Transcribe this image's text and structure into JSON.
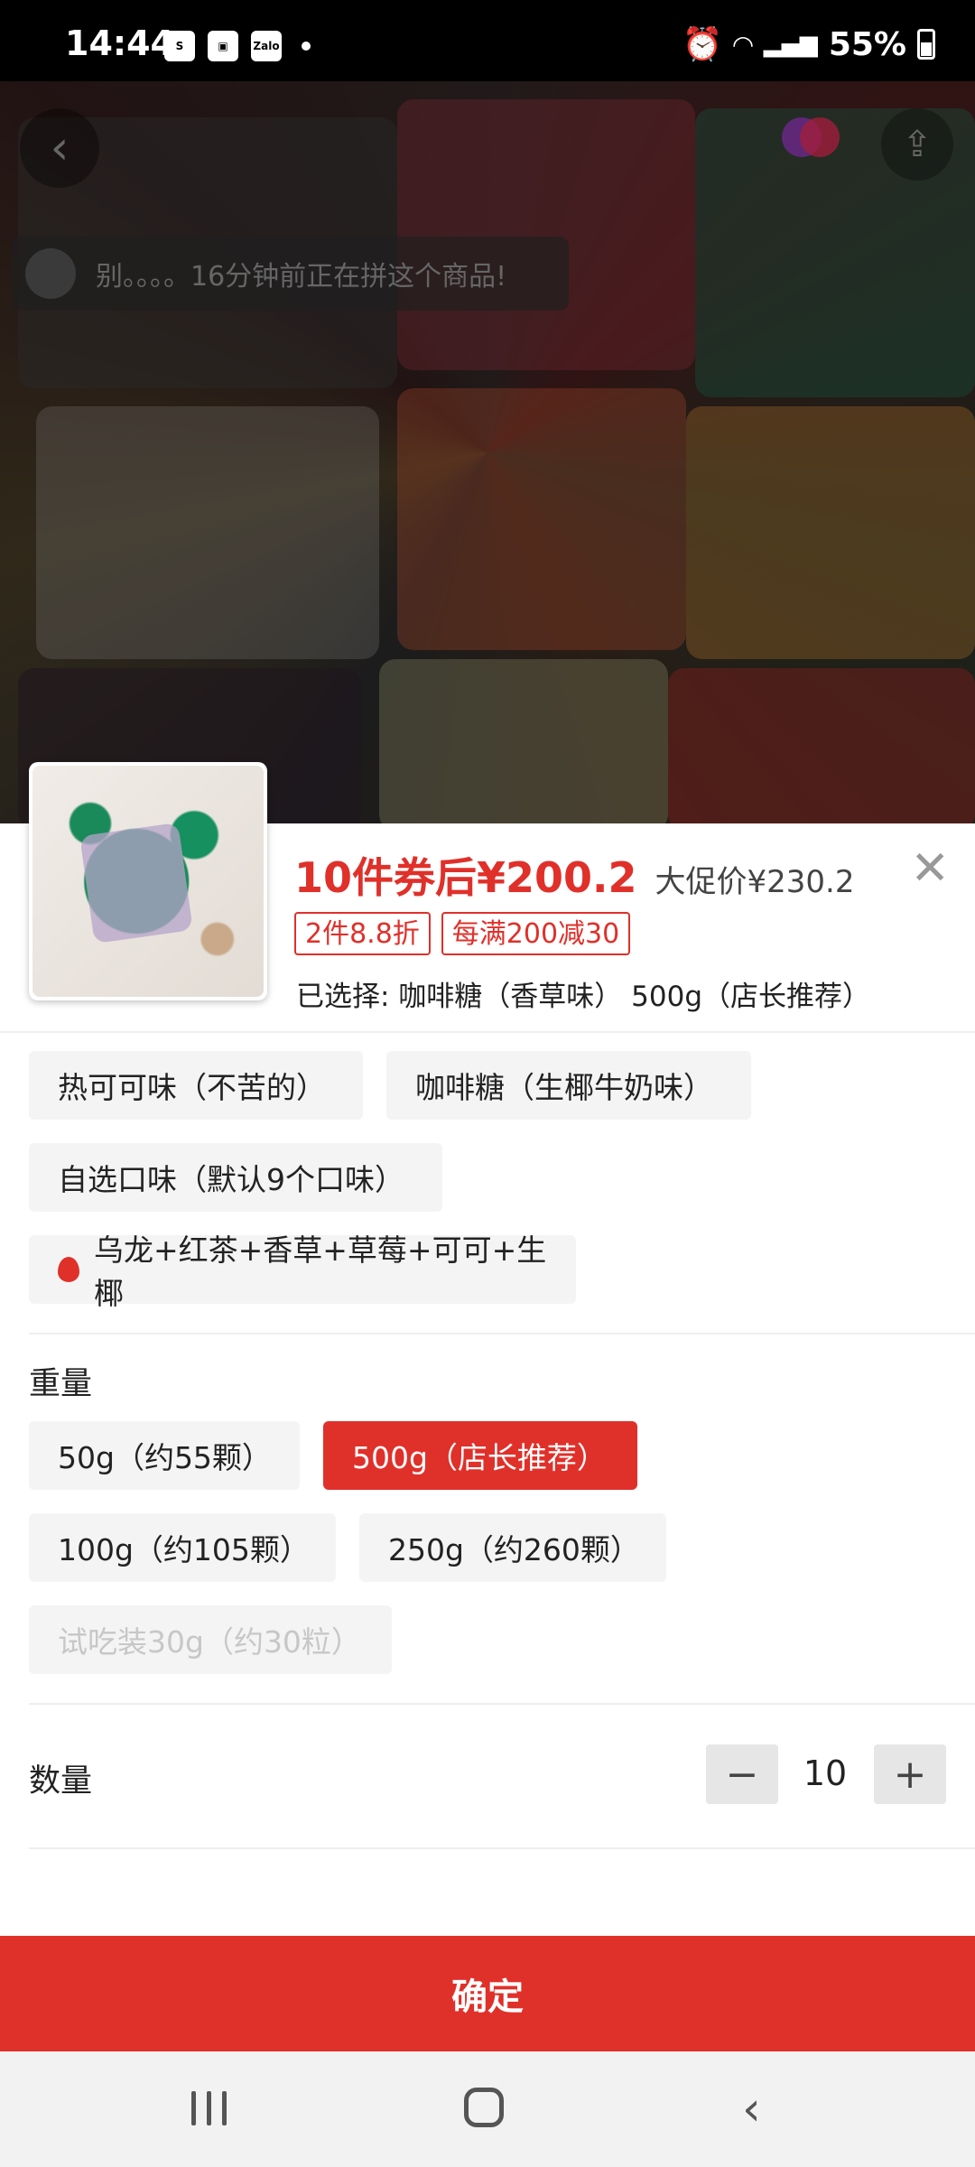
{
  "status_bar": {
    "time": "14:44",
    "battery": "55%",
    "left_icons": [
      "shopee-icon",
      "gallery-icon",
      "zalo-icon"
    ],
    "zalo_label": "Zalo",
    "shop_label": "S"
  },
  "hero": {
    "notice_text": "别。。。。16分钟前正在拼这个商品!"
  },
  "product": {
    "price_main": "10件券后¥200.2",
    "price_promo": "大促价¥230.2",
    "tags": [
      "2件8.8折",
      "每满200减30"
    ],
    "selected": "已选择:  咖啡糖（香草味） 500g（店长推荐）"
  },
  "flavors": [
    "热可可味（不苦的）",
    "咖啡糖（生椰牛奶味）",
    "自选口味（默认9个口味）",
    "乌龙+红茶+香草+草莓+可可+生椰"
  ],
  "weight": {
    "title": "重量",
    "options": [
      "50g（约55颗）",
      "500g（店长推荐）",
      "100g（约105颗）",
      "250g（约260颗）",
      "试吃装30g（约30粒）"
    ],
    "selected_index": 1,
    "disabled_index": 4
  },
  "quantity": {
    "title": "数量",
    "value": "10",
    "minus": "−",
    "plus": "+"
  },
  "confirm_label": "确定",
  "colors": {
    "accent": "#e0302a"
  }
}
